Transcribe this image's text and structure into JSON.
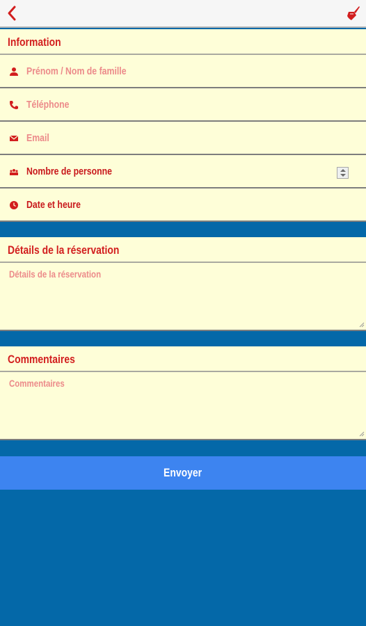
{
  "colors": {
    "accent": "#d21e1e",
    "background": "#0468a8",
    "field_bg": "#fefed8",
    "button": "#3d84f0"
  },
  "topbar": {
    "back_icon": "back-arrow-icon",
    "action_icon": "brush-icon"
  },
  "information": {
    "title": "Information",
    "fields": [
      {
        "icon": "person-icon",
        "placeholder": "Prénom / Nom de famille"
      },
      {
        "icon": "phone-icon",
        "placeholder": "Téléphone"
      },
      {
        "icon": "email-icon",
        "placeholder": "Email"
      },
      {
        "icon": "group-icon",
        "label": "Nombre de personne"
      },
      {
        "icon": "clock-icon",
        "label": "Date et heure"
      }
    ]
  },
  "details": {
    "title": "Détails de la réservation",
    "placeholder": "Détails de la réservation"
  },
  "comments": {
    "title": "Commentaires",
    "placeholder": "Commentaires"
  },
  "submit": {
    "label": "Envoyer"
  }
}
